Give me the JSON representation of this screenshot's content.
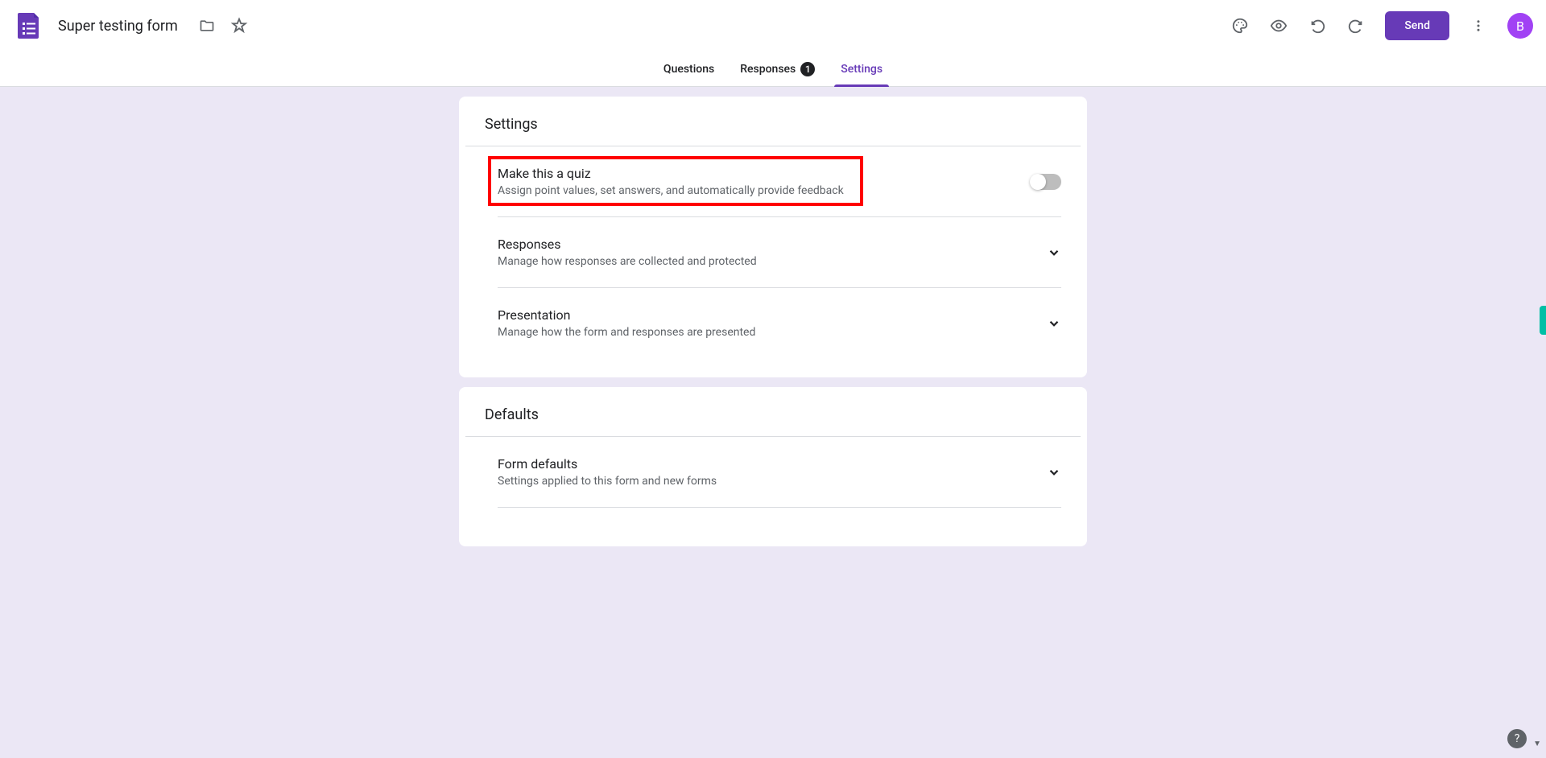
{
  "header": {
    "form_title": "Super testing form",
    "send_label": "Send",
    "avatar_letter": "B"
  },
  "tabs": {
    "questions": "Questions",
    "responses": "Responses",
    "responses_badge": "1",
    "settings": "Settings"
  },
  "settings_card": {
    "title": "Settings",
    "quiz": {
      "label": "Make this a quiz",
      "desc": "Assign point values, set answers, and automatically provide feedback"
    },
    "responses": {
      "label": "Responses",
      "desc": "Manage how responses are collected and protected"
    },
    "presentation": {
      "label": "Presentation",
      "desc": "Manage how the form and responses are presented"
    }
  },
  "defaults_card": {
    "title": "Defaults",
    "form_defaults": {
      "label": "Form defaults",
      "desc": "Settings applied to this form and new forms"
    }
  }
}
